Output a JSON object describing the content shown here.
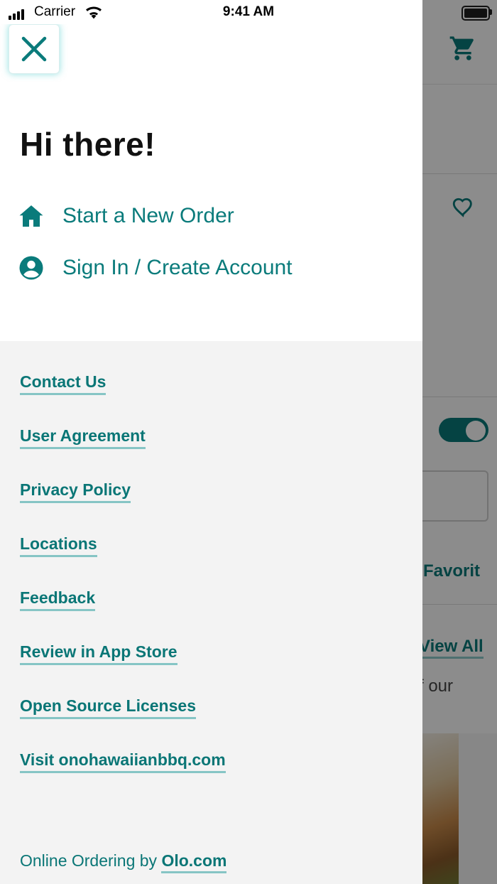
{
  "status_bar": {
    "carrier": "Carrier",
    "time": "9:41 AM"
  },
  "drawer": {
    "close_icon": "close-icon",
    "greeting": "Hi there!",
    "menu": [
      {
        "label": "Start a New Order",
        "icon": "home-icon"
      },
      {
        "label": "Sign In / Create Account",
        "icon": "account-circle-icon"
      }
    ],
    "links": [
      "Contact Us",
      "User Agreement",
      "Privacy Policy",
      "Locations",
      "Feedback",
      "Review in App Store",
      "Open Source Licenses",
      "Visit onohawaiianbbq.com"
    ],
    "footer": {
      "prefix": "Online Ordering by",
      "link": "Olo.com"
    }
  },
  "background": {
    "favorites_label": "Favorit",
    "view_all_label": "View All",
    "body_fragment": "f our",
    "icons": [
      "cart-icon",
      "heart-icon"
    ]
  },
  "colors": {
    "accent": "#0a7b7b",
    "underline": "#86c5c5",
    "drawer_bottom_bg": "#f3f3f3"
  }
}
